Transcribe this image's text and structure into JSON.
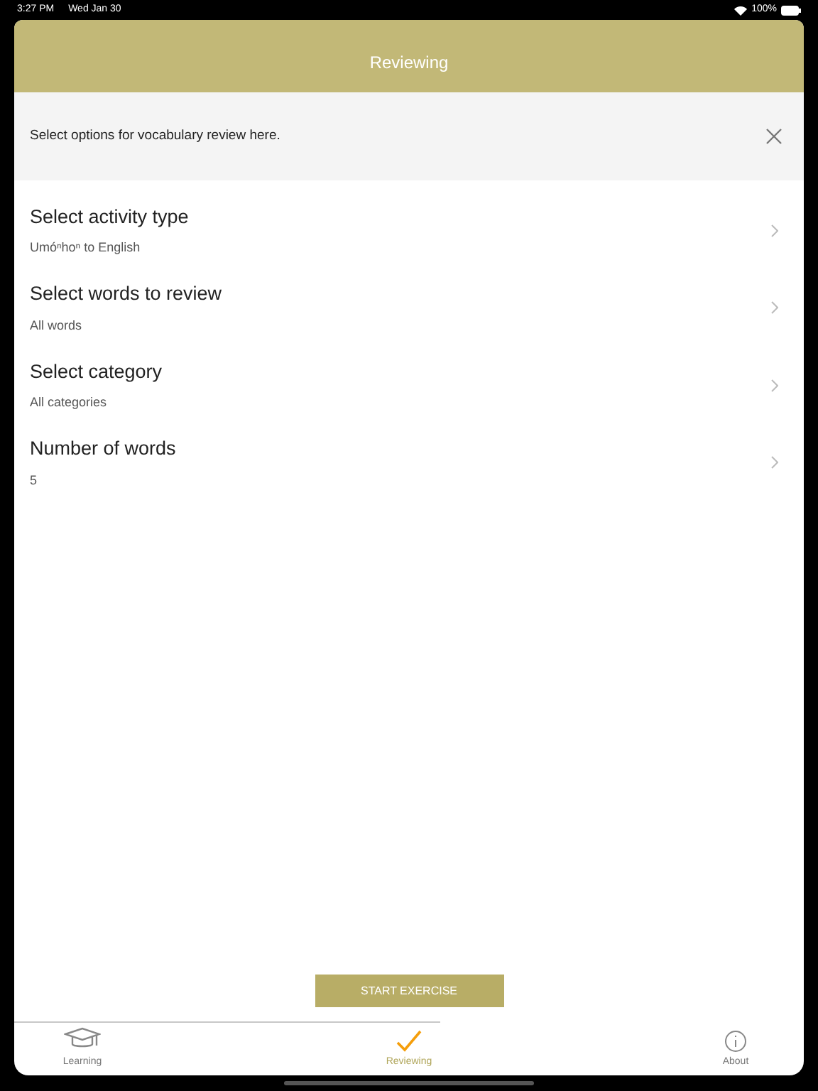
{
  "status_bar": {
    "time": "3:27 PM",
    "date": "Wed Jan 30",
    "battery": "100%"
  },
  "header": {
    "title": "Reviewing"
  },
  "banner": {
    "text": "Select options for vocabulary review here."
  },
  "options": [
    {
      "title": "Select activity type",
      "value": "Umóⁿhoⁿ to English"
    },
    {
      "title": "Select words to review",
      "value": "All words"
    },
    {
      "title": "Select category",
      "value": "All categories"
    },
    {
      "title": "Number of words",
      "value": "5"
    }
  ],
  "start_button": "START EXERCISE",
  "tabs": [
    {
      "kind": "learning",
      "label": "Learning",
      "selected": false
    },
    {
      "kind": "reviewing",
      "label": "Reviewing",
      "selected": true
    },
    {
      "kind": "about",
      "label": "About",
      "selected": false
    }
  ]
}
